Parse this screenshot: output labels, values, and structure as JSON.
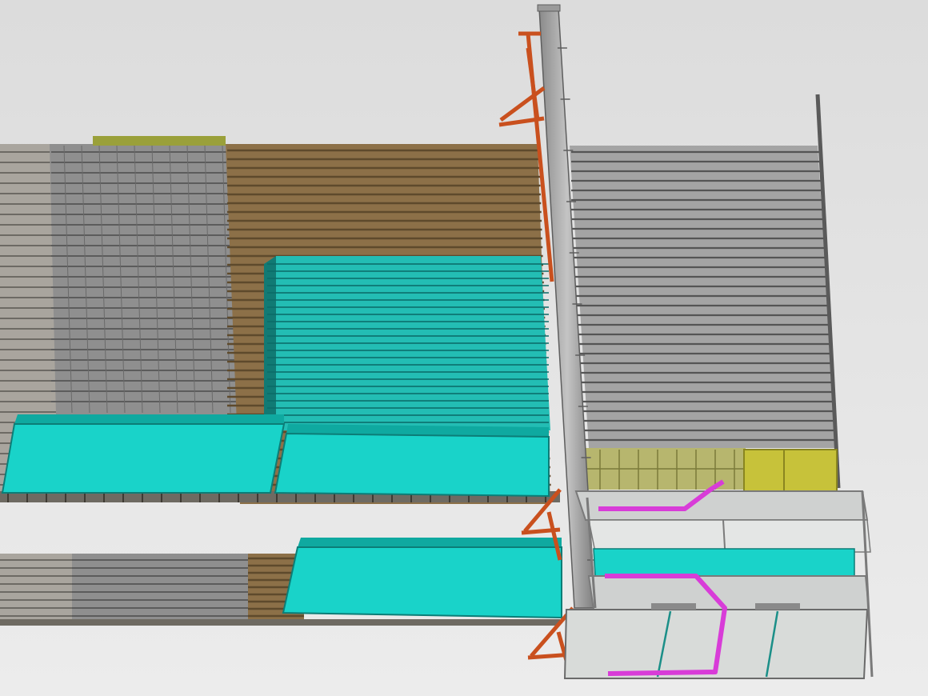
{
  "view": {
    "background_top": "#dcdcdc",
    "background_bottom": "#ececec"
  },
  "palette": {
    "cyan_panel": "#19d3c9",
    "cyan_panel_dark": "#0fa9a0",
    "cyan_stack": "#23bdb4",
    "wood_rack": "#8c7048",
    "wood_rack_line": "#5e4a2c",
    "grey_rack": "#8f8f8f",
    "grey_rack_line": "#5c5c5c",
    "light_grey_rack": "#a9a59e",
    "steel_column": "#a8a8a8",
    "steel_column_dark": "#6f6f6f",
    "orange_bracket": "#c9501e",
    "magenta_pipe": "#d83cd8",
    "yellow_green_panel": "#c7c23a",
    "olive_strip": "#9aa03a",
    "cabinet_face": "#d8dbd9",
    "cabinet_frame": "#7a7a7a"
  },
  "components": [
    "upper-rack-light",
    "upper-rack-grey",
    "upper-rack-wood",
    "upper-rack-olive-strip",
    "cyan-panel-stack",
    "cyan-panel-upper-left",
    "cyan-panel-upper-right",
    "lower-rack-light",
    "lower-rack-grey",
    "lower-rack-wood",
    "cyan-panel-lower",
    "louvered-wall",
    "yellow-green-panel",
    "steel-column",
    "orange-bracket-top",
    "orange-bracket-middle",
    "orange-bracket-bottom",
    "tall-pole",
    "machine-cabinet",
    "magenta-pipe-upper",
    "magenta-pipe-lower"
  ]
}
